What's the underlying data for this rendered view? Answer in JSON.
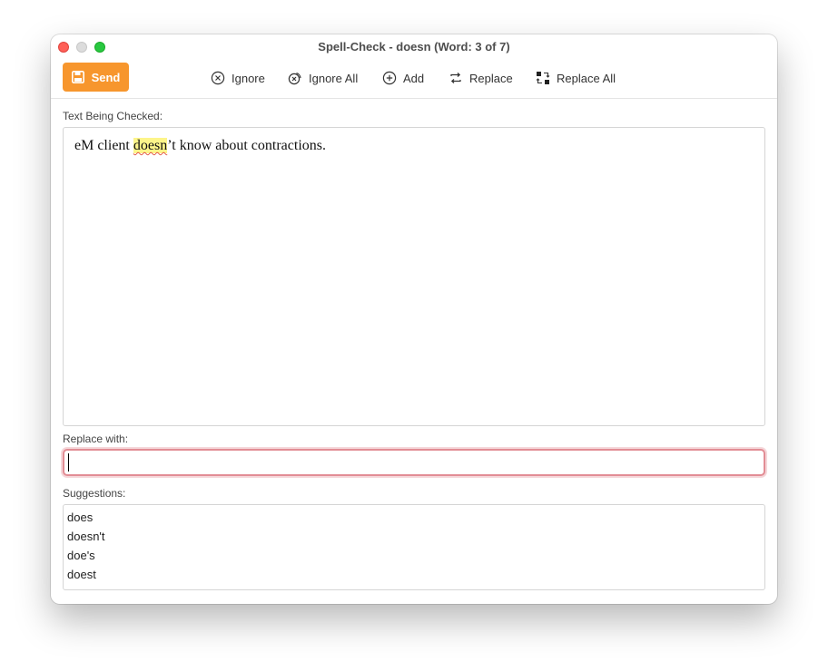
{
  "window": {
    "title": "Spell-Check - doesn (Word: 3 of 7)"
  },
  "toolbar": {
    "send_label": "Send",
    "ignore_label": "Ignore",
    "ignore_all_label": "Ignore All",
    "add_label": "Add",
    "replace_label": "Replace",
    "replace_all_label": "Replace All"
  },
  "checked_text": {
    "label": "Text Being Checked:",
    "before": "eM client ",
    "misspelled": "doesn",
    "after": "’t know about contractions."
  },
  "replace": {
    "label": "Replace with:",
    "value": "",
    "placeholder": ""
  },
  "suggestions": {
    "label": "Suggestions:",
    "items": [
      "does",
      "doesn't",
      "doe's",
      "doest"
    ]
  },
  "colors": {
    "send_button": "#f7962d",
    "highlight": "#fdf58a",
    "focus_ring": "#e28d95"
  },
  "icons": {
    "send": "save-icon",
    "ignore": "x-circle-icon",
    "ignore_all": "x-circle-double-icon",
    "add": "plus-circle-icon",
    "replace": "swap-arrows-icon",
    "replace_all": "replace-all-icon"
  }
}
